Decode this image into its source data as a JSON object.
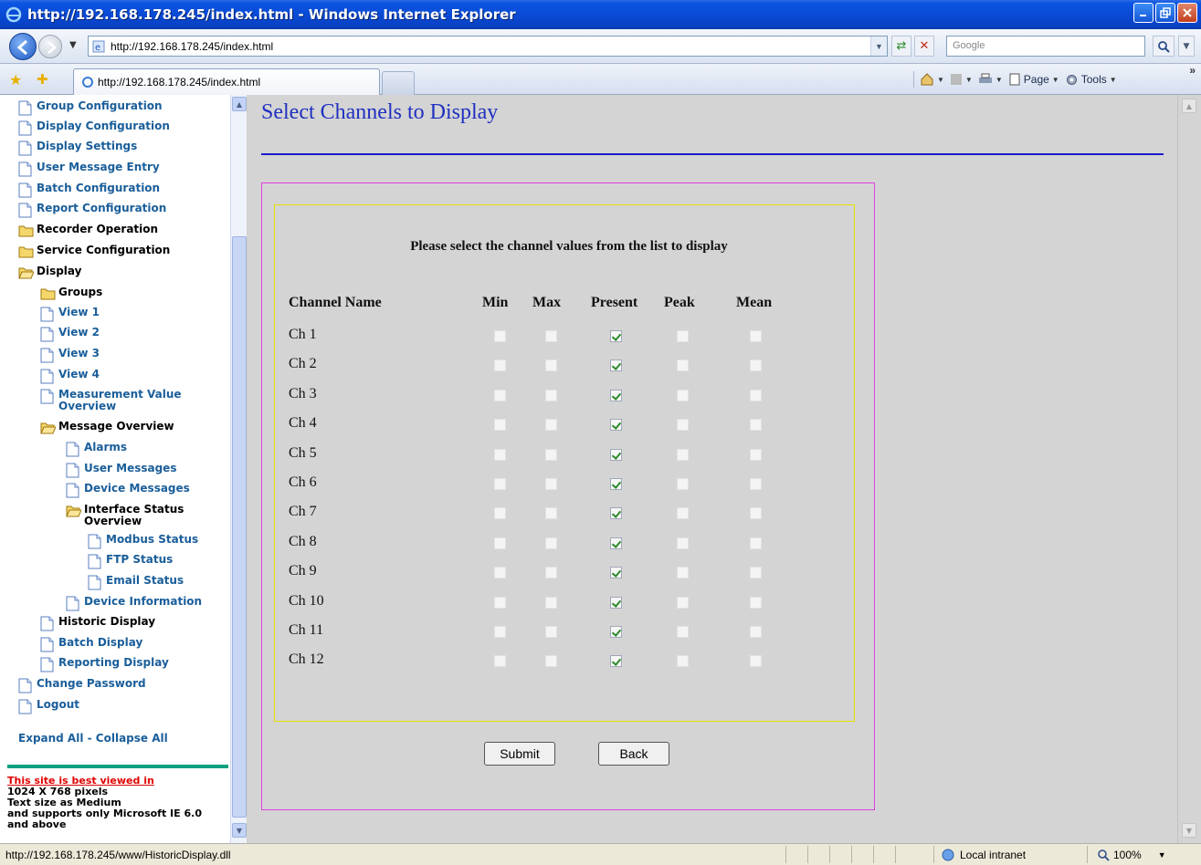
{
  "window": {
    "title": "http://192.168.178.245/index.html - Windows Internet Explorer"
  },
  "addressbar": {
    "url": "http://192.168.178.245/index.html",
    "search_placeholder": "Google"
  },
  "tabs": {
    "active_tab_label": "http://192.168.178.245/index.html"
  },
  "commandbar": {
    "page_label": "Page",
    "tools_label": "Tools",
    "overflow_label": "»"
  },
  "tree": {
    "items": [
      {
        "label": "Group Configuration",
        "icon": "page",
        "dark": false
      },
      {
        "label": "Display Configuration",
        "icon": "page",
        "dark": false
      },
      {
        "label": "Display Settings",
        "icon": "page",
        "dark": false
      },
      {
        "label": "User Message Entry",
        "icon": "page",
        "dark": false
      },
      {
        "label": "Batch Configuration",
        "icon": "page",
        "dark": false
      },
      {
        "label": "Report Configuration",
        "icon": "page",
        "dark": false
      },
      {
        "label": "Recorder Operation",
        "icon": "folder-closed",
        "dark": true
      },
      {
        "label": "Service Configuration",
        "icon": "folder-closed",
        "dark": true
      },
      {
        "label": "Display",
        "icon": "folder-open",
        "dark": true
      },
      {
        "label": "Groups",
        "icon": "folder-closed",
        "dark": true
      },
      {
        "label": "View 1",
        "icon": "page",
        "dark": false
      },
      {
        "label": "View 2",
        "icon": "page",
        "dark": false
      },
      {
        "label": "View 3",
        "icon": "page",
        "dark": false
      },
      {
        "label": "View 4",
        "icon": "page",
        "dark": false
      },
      {
        "label": "Measurement Value Overview",
        "icon": "page",
        "dark": false
      },
      {
        "label": "Message Overview",
        "icon": "folder-open",
        "dark": true
      },
      {
        "label": "Alarms",
        "icon": "page",
        "dark": false
      },
      {
        "label": "User Messages",
        "icon": "page",
        "dark": false
      },
      {
        "label": "Device Messages",
        "icon": "page",
        "dark": false
      },
      {
        "label": "Interface Status Overview",
        "icon": "folder-open",
        "dark": true
      },
      {
        "label": "Modbus Status",
        "icon": "page",
        "dark": false
      },
      {
        "label": "FTP Status",
        "icon": "page",
        "dark": false
      },
      {
        "label": "Email Status",
        "icon": "page",
        "dark": false
      },
      {
        "label": "Device Information",
        "icon": "page",
        "dark": false
      },
      {
        "label": "Historic Display",
        "icon": "page",
        "dark": true
      },
      {
        "label": "Batch Display",
        "icon": "page",
        "dark": false
      },
      {
        "label": "Reporting Display",
        "icon": "page",
        "dark": false
      },
      {
        "label": "Change Password",
        "icon": "page",
        "dark": false
      },
      {
        "label": "Logout",
        "icon": "page",
        "dark": false
      }
    ],
    "expand_collapse_label": "Expand All - Collapse All",
    "notice_heading": "This site is best viewed in",
    "notice_lines": [
      "1024 X 768 pixels",
      "Text size as Medium",
      "and supports only Microsoft IE 6.0",
      "and above"
    ]
  },
  "main": {
    "title": "Select Channels to Display",
    "instruction": "Please select the channel values from the list to display",
    "columns": {
      "name": "Channel Name",
      "min": "Min",
      "max": "Max",
      "present": "Present",
      "peak": "Peak",
      "mean": "Mean"
    },
    "channels": [
      {
        "name": "Ch 1",
        "min": false,
        "max": false,
        "present": true,
        "peak": false,
        "mean": false
      },
      {
        "name": "Ch 2",
        "min": false,
        "max": false,
        "present": true,
        "peak": false,
        "mean": false
      },
      {
        "name": "Ch 3",
        "min": false,
        "max": false,
        "present": true,
        "peak": false,
        "mean": false
      },
      {
        "name": "Ch 4",
        "min": false,
        "max": false,
        "present": true,
        "peak": false,
        "mean": false
      },
      {
        "name": "Ch 5",
        "min": false,
        "max": false,
        "present": true,
        "peak": false,
        "mean": false
      },
      {
        "name": "Ch 6",
        "min": false,
        "max": false,
        "present": true,
        "peak": false,
        "mean": false
      },
      {
        "name": "Ch 7",
        "min": false,
        "max": false,
        "present": true,
        "peak": false,
        "mean": false
      },
      {
        "name": "Ch 8",
        "min": false,
        "max": false,
        "present": true,
        "peak": false,
        "mean": false
      },
      {
        "name": "Ch 9",
        "min": false,
        "max": false,
        "present": true,
        "peak": false,
        "mean": false
      },
      {
        "name": "Ch 10",
        "min": false,
        "max": false,
        "present": true,
        "peak": false,
        "mean": false
      },
      {
        "name": "Ch 11",
        "min": false,
        "max": false,
        "present": true,
        "peak": false,
        "mean": false
      },
      {
        "name": "Ch 12",
        "min": false,
        "max": false,
        "present": true,
        "peak": false,
        "mean": false
      }
    ],
    "submit_label": "Submit",
    "back_label": "Back"
  },
  "statusbar": {
    "url": "http://192.168.178.245/www/HistoricDisplay.dll",
    "zone": "Local intranet",
    "zoom": "100%"
  },
  "colors": {
    "title_blue": "#2030c0",
    "rule_blue": "#1a1acc",
    "outer_border": "#e040e0",
    "inner_border": "#e8e000",
    "tree_link": "#1a5e9a",
    "notice_red": "#e00000"
  }
}
